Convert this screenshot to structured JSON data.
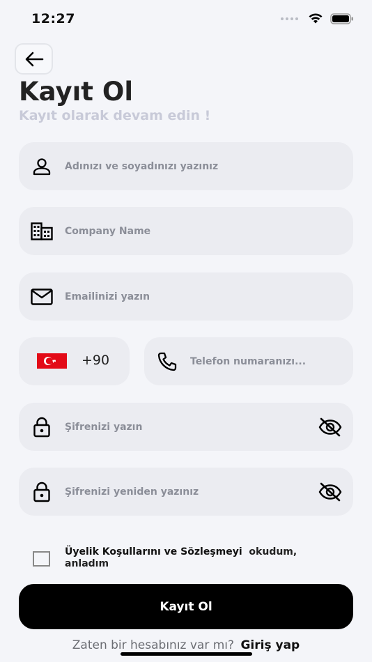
{
  "status_bar": {
    "time": "12:27"
  },
  "header": {
    "title": "Kayıt Ol",
    "subtitle": "Kayıt olarak devam edin !"
  },
  "form": {
    "name_placeholder": "Adınızı ve soyadınızı yazınız",
    "company_placeholder": "Company Name",
    "email_placeholder": "Emailinizi yazın",
    "country_code": "+90",
    "phone_placeholder": "Telefon numaranızı...",
    "password_placeholder": "Şifrenizi yazın",
    "password_repeat_placeholder": "Şifrenizi yeniden yazınız",
    "terms_link": "Üyelik Koşullarını ve Sözleşmeyi",
    "terms_suffix": "okudum, anladım",
    "submit_label": "Kayıt Ol"
  },
  "footer": {
    "prompt": "Zaten bir hesabınız var mı?",
    "login_link": "Giriş yap"
  },
  "colors": {
    "background": "#f4f5f9",
    "field_background": "#ebecf1",
    "primary": "#000000",
    "subtitle": "#c8cad8",
    "flag_red": "#e30a17"
  },
  "icons": {
    "back": "arrow-left-icon",
    "name": "person-icon",
    "company": "building-icon",
    "email": "mail-icon",
    "phone": "phone-icon",
    "password": "lock-icon",
    "toggle": "eye-off-icon"
  }
}
